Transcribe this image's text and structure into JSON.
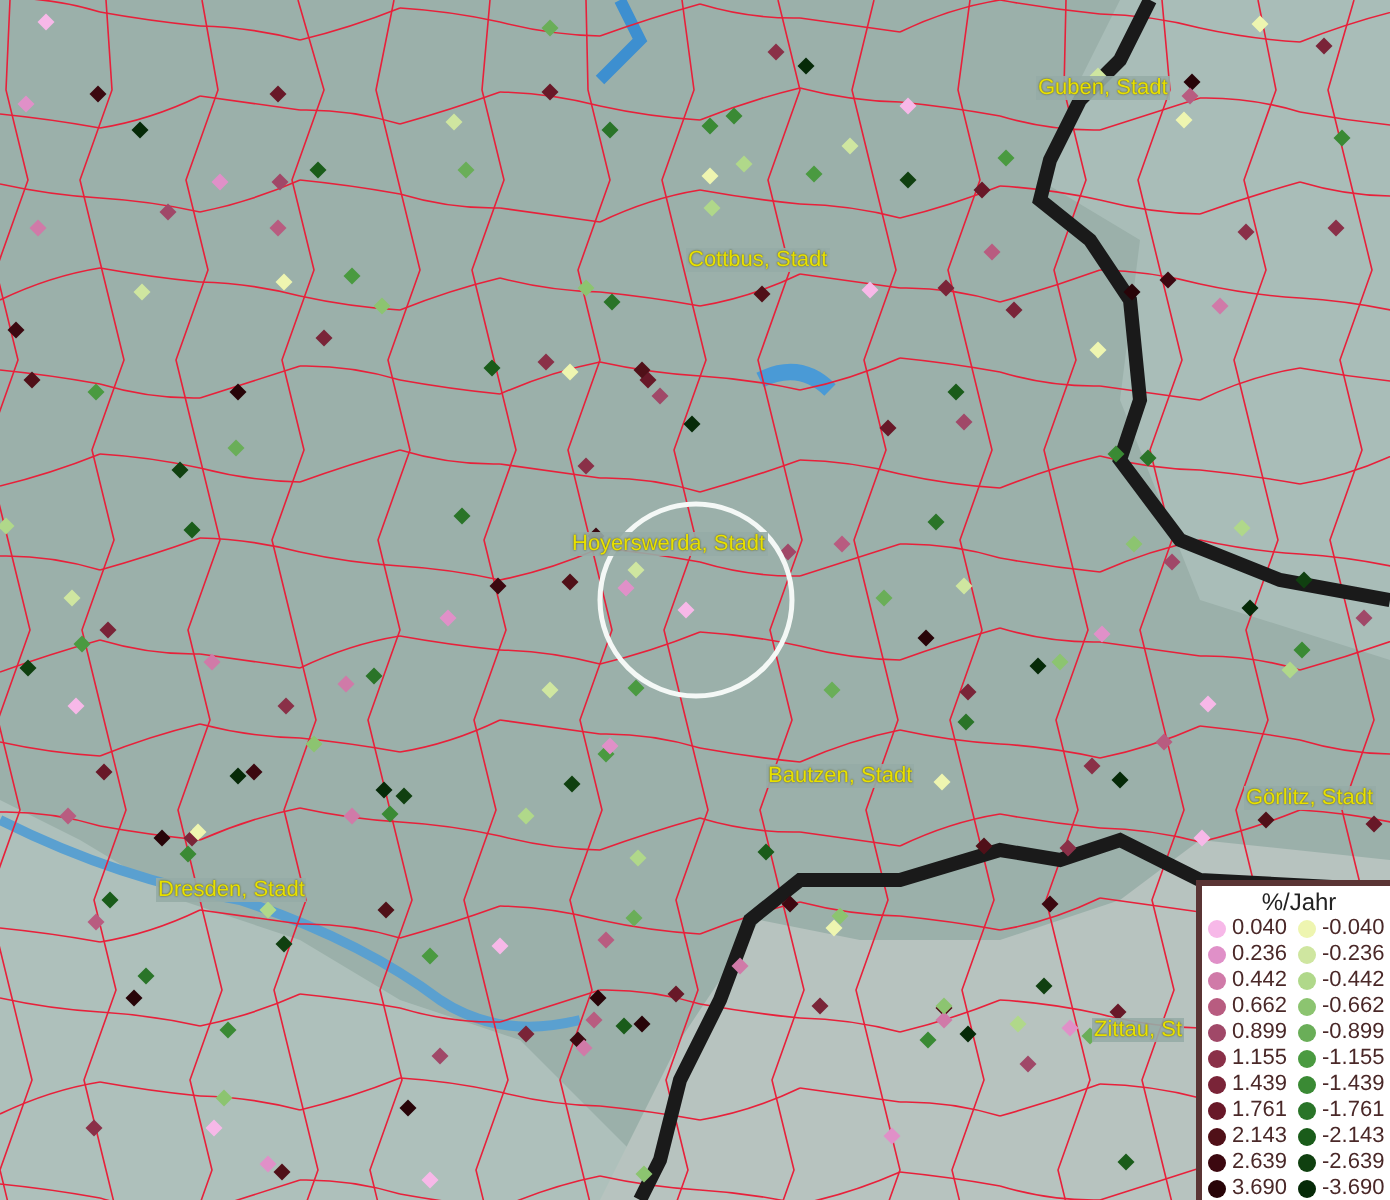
{
  "map": {
    "places": [
      {
        "label": "Guben, Stadt"
      },
      {
        "label": "Cottbus, Stadt"
      },
      {
        "label": "Hoyerswerda, Stadt"
      },
      {
        "label": "Bautzen, Stadt"
      },
      {
        "label": "Görlitz, Stadt"
      },
      {
        "label": "Dresden, Stadt"
      },
      {
        "label": "Zittau, St"
      }
    ]
  },
  "legend": {
    "title": "%/Jahr",
    "items": [
      {
        "label": "0.040",
        "color": "#f7b8e8"
      },
      {
        "label": "-0.040",
        "color": "#eef5b0"
      },
      {
        "label": "0.236",
        "color": "#e090c8"
      },
      {
        "label": "-0.236",
        "color": "#cfe6a0"
      },
      {
        "label": "0.442",
        "color": "#d07aa8"
      },
      {
        "label": "-0.442",
        "color": "#b0d88a"
      },
      {
        "label": "0.662",
        "color": "#b85c80"
      },
      {
        "label": "-0.662",
        "color": "#8cc470"
      },
      {
        "label": "0.899",
        "color": "#a04868"
      },
      {
        "label": "-0.899",
        "color": "#6aae58"
      },
      {
        "label": "1.155",
        "color": "#8a3048"
      },
      {
        "label": "-1.155",
        "color": "#4a9a40"
      },
      {
        "label": "1.439",
        "color": "#7a2438"
      },
      {
        "label": "-1.439",
        "color": "#3a8a34"
      },
      {
        "label": "1.761",
        "color": "#681828"
      },
      {
        "label": "-1.761",
        "color": "#2a7428"
      },
      {
        "label": "2.143",
        "color": "#501018"
      },
      {
        "label": "-2.143",
        "color": "#1a5c1a"
      },
      {
        "label": "2.639",
        "color": "#3c0810"
      },
      {
        "label": "-2.639",
        "color": "#104010"
      },
      {
        "label": "3.690",
        "color": "#280408"
      },
      {
        "label": "-3.690",
        "color": "#062a08"
      }
    ]
  }
}
